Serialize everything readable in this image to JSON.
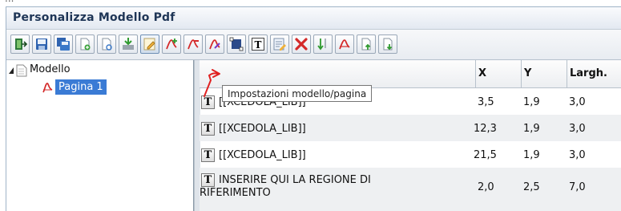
{
  "top_fragment": "...",
  "window": {
    "title": "Personalizza Modello Pdf"
  },
  "toolbar": {
    "buttons": [
      {
        "icon": "exit-icon"
      },
      {
        "icon": "save-icon"
      },
      {
        "icon": "save-as-icon"
      },
      {
        "icon": "new-page-icon"
      },
      {
        "icon": "preview-page-icon"
      },
      {
        "icon": "import-icon"
      },
      {
        "icon": "edit-settings-icon"
      },
      {
        "icon": "add-pdf-field-icon"
      },
      {
        "icon": "remove-pdf-field-icon"
      },
      {
        "icon": "pdf-tool-icon"
      },
      {
        "icon": "rectangle-icon"
      },
      {
        "icon": "text-icon"
      },
      {
        "icon": "edit-text-icon"
      },
      {
        "icon": "delete-icon"
      },
      {
        "icon": "sort-down-icon"
      },
      {
        "icon": "pdf-icon"
      },
      {
        "icon": "page-up-icon"
      },
      {
        "icon": "page-down-icon"
      }
    ]
  },
  "tree": {
    "root": "Modello",
    "child": "Pagina 1"
  },
  "grid": {
    "columns": [
      "",
      "X",
      "Y",
      "Largh."
    ],
    "rows": [
      {
        "icon_label": "T",
        "text": "[[XCEDOLA_LIB]]",
        "x": "3,5",
        "y": "1,9",
        "w": "3,0"
      },
      {
        "icon_label": "T",
        "text": "[[XCEDOLA_LIB]]",
        "x": "12,3",
        "y": "1,9",
        "w": "3,0"
      },
      {
        "icon_label": "T",
        "text": "[[XCEDOLA_LIB]]",
        "x": "21,5",
        "y": "1,9",
        "w": "3,0"
      },
      {
        "icon_label": "T",
        "text": "INSERIRE QUI LA REGIONE DI",
        "text2": "RIFERIMENTO",
        "x": "2,0",
        "y": "2,5",
        "w": "7,0"
      }
    ]
  },
  "tooltip": "Impostazioni modello/pagina",
  "colors": {
    "title": "#1e3556",
    "selection": "#3a7bd5",
    "pointer_arrow": "#e02020",
    "pdf_red": "#d42a2a"
  }
}
